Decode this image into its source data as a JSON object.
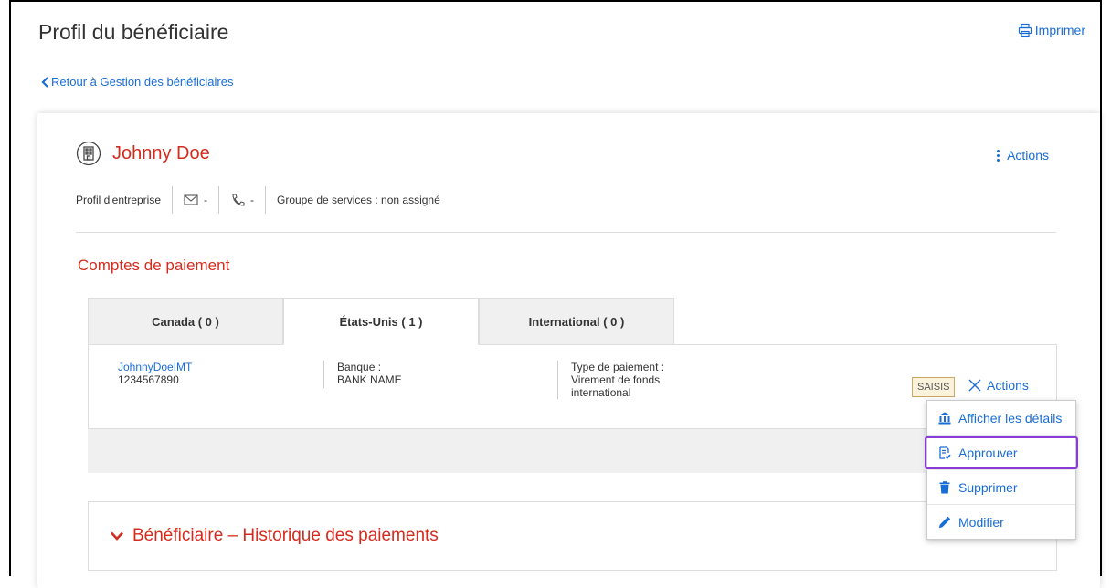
{
  "header": {
    "title": "Profil du bénéficiaire",
    "print_label": "Imprimer",
    "back_label": "Retour à Gestion des bénéficiaires"
  },
  "beneficiary": {
    "name": "Johnny Doe",
    "actions_label": "Actions",
    "profile_type": "Profil d'entreprise",
    "email": "-",
    "phone": "-",
    "service_group": "Groupe de services : non assigné"
  },
  "payment_accounts": {
    "title": "Comptes de paiement",
    "tabs": [
      {
        "label": "Canada ( 0 )",
        "active": false
      },
      {
        "label": "États-Unis ( 1 )",
        "active": true
      },
      {
        "label": "International ( 0 )",
        "active": false
      }
    ],
    "account": {
      "name": "JohnnyDoeIMT",
      "number": "1234567890",
      "bank_label": "Banque :",
      "bank_value": "BANK NAME",
      "type_label": "Type de paiement :",
      "type_value_line1": "Virement de fonds",
      "type_value_line2": "international",
      "status_badge": "SAISIS",
      "actions_label": "Actions"
    }
  },
  "actions_menu": {
    "items": [
      {
        "label": "Afficher les détails",
        "icon": "bank-icon"
      },
      {
        "label": "Approuver",
        "icon": "approve-document-icon"
      },
      {
        "label": "Supprimer",
        "icon": "trash-icon"
      },
      {
        "label": "Modifier",
        "icon": "pencil-icon"
      }
    ]
  },
  "history": {
    "title": "Bénéficiaire – Historique des paiements"
  },
  "colors": {
    "accent_red": "#d52b1e",
    "link_blue": "#1a6dd6",
    "highlight_purple": "#8b3cd6"
  }
}
